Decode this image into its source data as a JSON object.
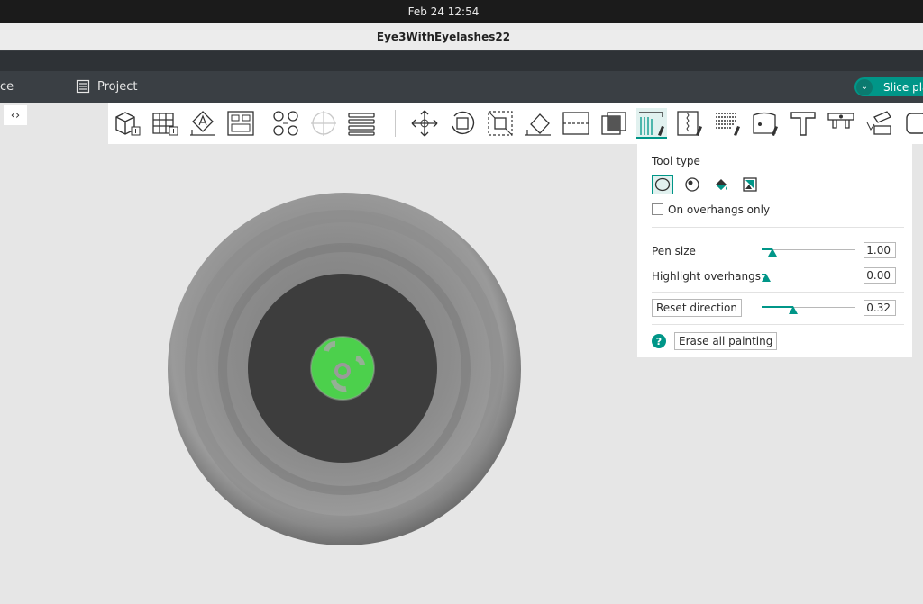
{
  "system": {
    "clock": "Feb 24  12:54"
  },
  "window": {
    "title": "Eye3WithEyelashes22"
  },
  "tabs": {
    "prev_tab_partial": "ce",
    "project": "Project",
    "slice_partial": "Slice pla"
  },
  "panel": {
    "tool_type_label": "Tool type",
    "overhangs_only_label": "On overhangs only",
    "overhangs_only_checked": false,
    "pen_size_label": "Pen size",
    "pen_size_value": "1.00",
    "pen_size_fraction": 0.12,
    "highlight_label": "Highlight overhangs",
    "highlight_value": "0.00",
    "highlight_fraction": 0.05,
    "reset_label": "Reset direction",
    "reset_value": "0.32",
    "reset_fraction": 0.34,
    "help_glyph": "?",
    "erase_label": "Erase all painting",
    "tool_types": [
      "circle-tool-icon",
      "sphere-tool-icon",
      "fill-tool-icon",
      "gap-fill-tool-icon"
    ]
  },
  "colors": {
    "accent": "#009688",
    "paint_green": "#4cd04c"
  }
}
